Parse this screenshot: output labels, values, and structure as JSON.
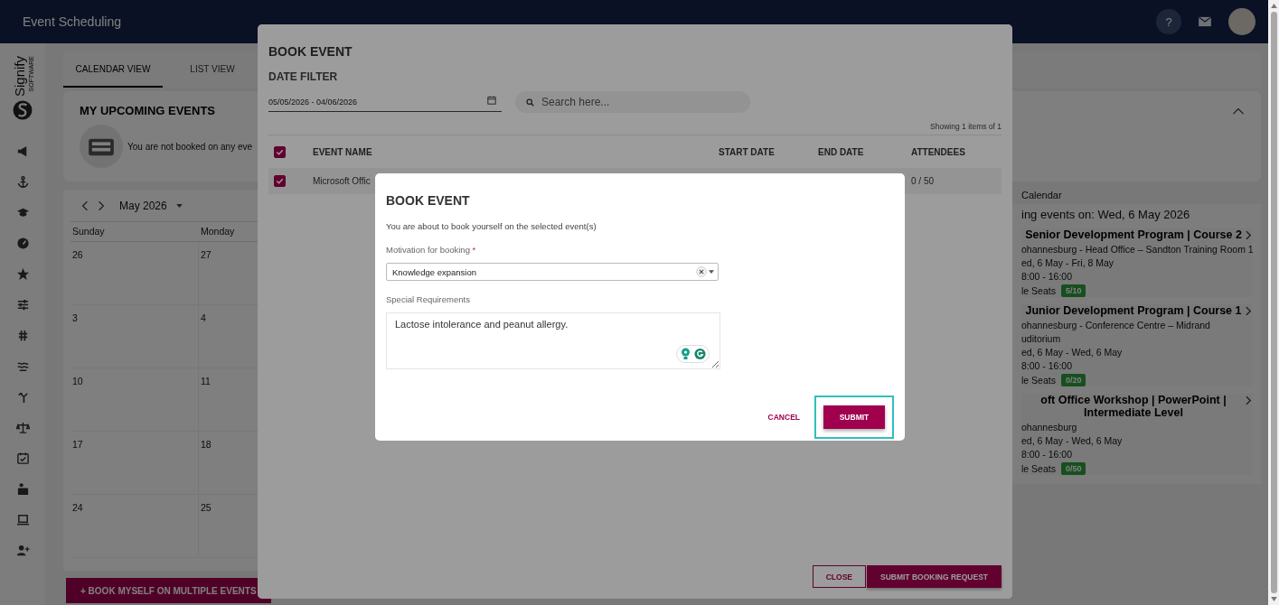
{
  "top_bar": {
    "title": "Event Scheduling",
    "help_label": "?"
  },
  "sidebar": {
    "logo_text": "Signify",
    "logo_subtext": "SOFTWARE"
  },
  "tabs": [
    {
      "label": "CALENDAR VIEW",
      "selected": true
    },
    {
      "label": "LIST VIEW",
      "selected": false
    }
  ],
  "upcoming": {
    "title": "MY UPCOMING EVENTS",
    "empty_message": "You are not booked on any eve",
    "expanded": true
  },
  "calendar": {
    "month": "May 2026",
    "weekdays": [
      "Sunday",
      "Monday"
    ],
    "weeks": [
      [
        "26",
        "27"
      ],
      [
        "3",
        "4"
      ],
      [
        "10",
        "11"
      ],
      [
        "17",
        "18"
      ],
      [
        "24",
        "25"
      ]
    ]
  },
  "day_panel": {
    "header": "Calendar",
    "heading": "ing events on: Wed, 6 May 2026",
    "events": [
      {
        "title": "Senior Development Program | Course 2",
        "location_lines": [
          "ohannesburg - Head Office – Sandton Training Room 1"
        ],
        "dates": "ed, 6 May - Fri, 8 May",
        "time": "8:00 - 16:00",
        "seats_label": "le Seats",
        "seats": "5/10"
      },
      {
        "title": "Junior Development Program | Course 1",
        "location_lines": [
          "ohannesburg - Conference Centre – Midrand",
          "uditorium"
        ],
        "dates": "ed, 6 May - Wed, 6 May",
        "time": "8:00 - 16:00",
        "seats_label": "le Seats",
        "seats": "0/20"
      },
      {
        "title": "oft Office Workshop | PowerPoint | Intermediate Level",
        "location_lines": [
          "ohannesburg"
        ],
        "dates": "ed, 6 May - Wed, 6 May",
        "time": "8:00 - 16:00",
        "seats_label": "le Seats",
        "seats": "0/50"
      }
    ]
  },
  "bottom_bar": {
    "button": "+ BOOK MYSELF ON MULTIPLE EVENTS"
  },
  "book_modal": {
    "title": "BOOK EVENT",
    "filter_label": "DATE FILTER",
    "date_range": "05/05/2026 - 04/06/2026",
    "search_placeholder": "Search here...",
    "showing": "Showing 1 items of 1",
    "select_all_checked": true,
    "columns": [
      "EVENT NAME",
      "START DATE",
      "END DATE",
      "ATTENDEES"
    ],
    "rows": [
      {
        "event_name": "Microsoft Offic",
        "attendees": "0 / 50",
        "checked": true
      }
    ],
    "close_button": "CLOSE",
    "submit_button": "SUBMIT BOOKING REQUEST"
  },
  "confirm_dialog": {
    "title": "BOOK EVENT",
    "message": "You are about to book yourself on the selected event(s)",
    "motivation_label": "Motivation for booking",
    "required_mark": "*",
    "motivation_value": "Knowledge expansion",
    "special_label": "Special Requirements",
    "special_value": "Lactose intolerance and peanut allergy.",
    "cancel_button": "CANCEL",
    "submit_button": "SUBMIT",
    "submit_focused": true
  }
}
